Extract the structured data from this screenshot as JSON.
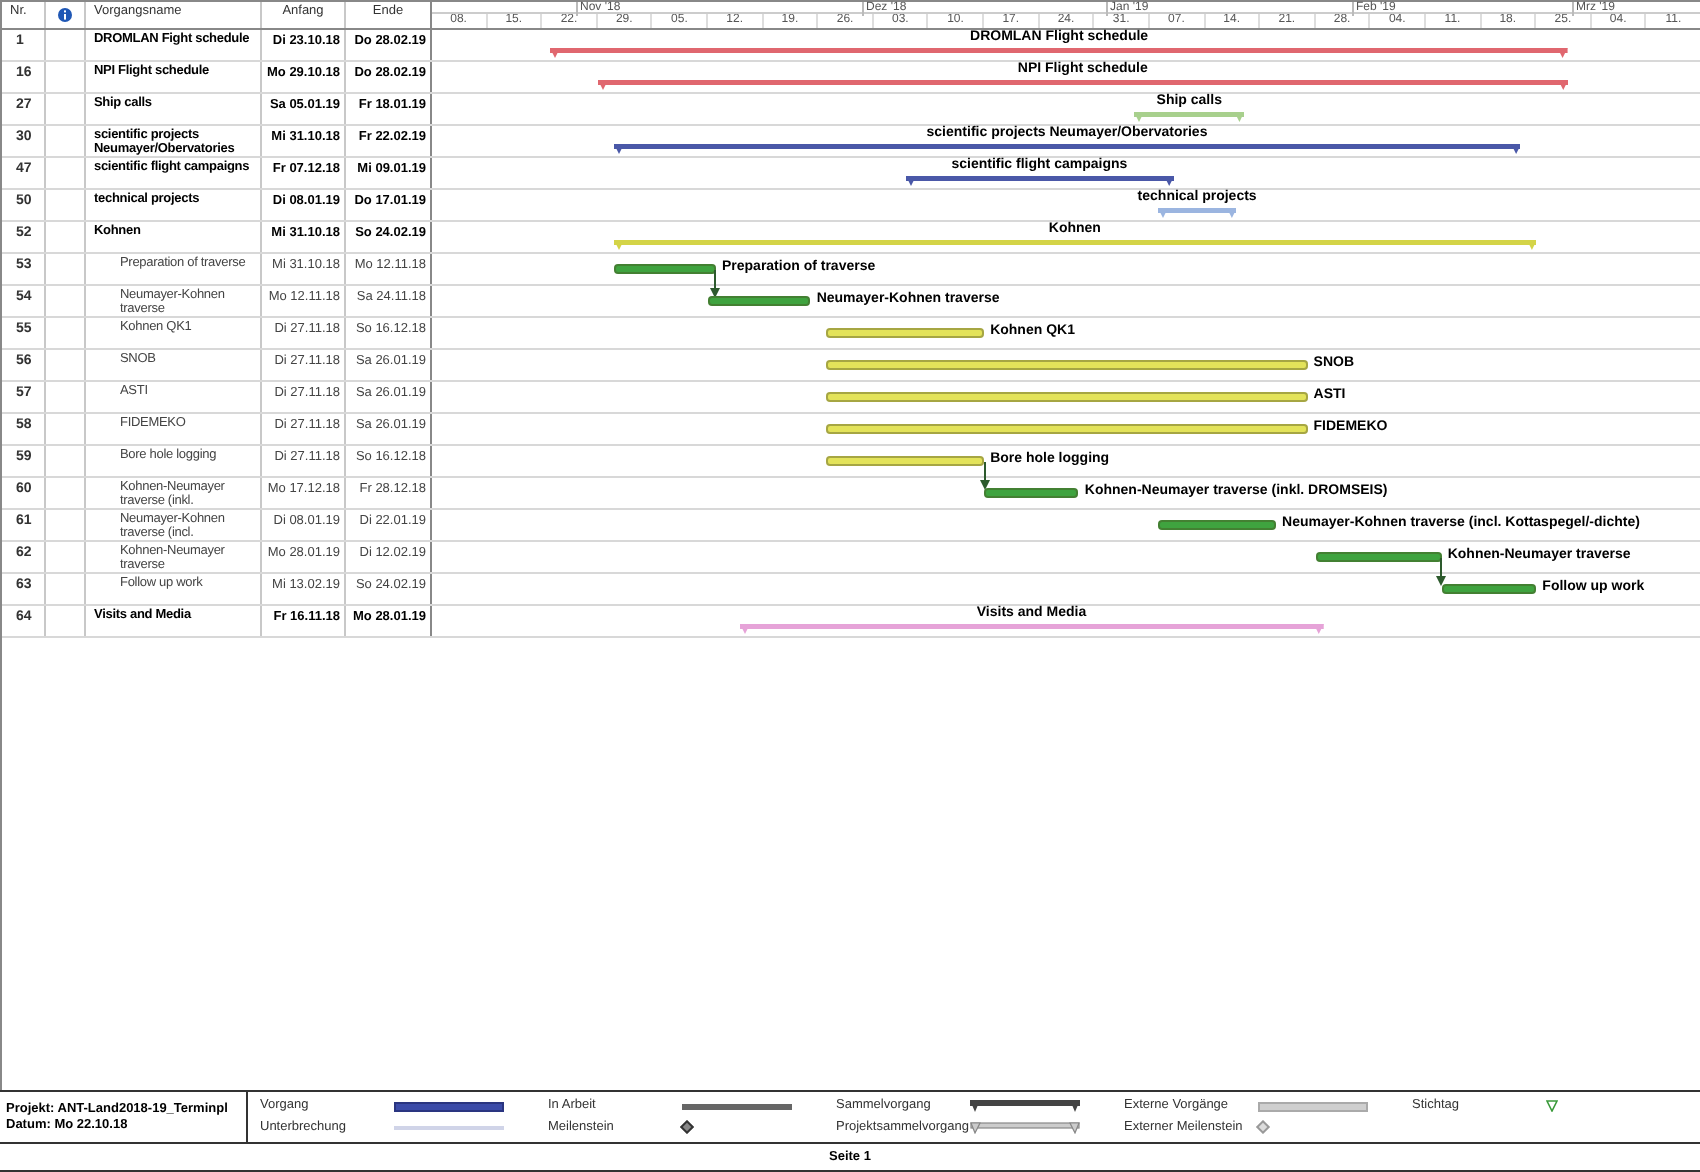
{
  "table": {
    "columns": [
      "Nr.",
      "Vorgangsname",
      "Anfang",
      "Ende"
    ]
  },
  "timeline": {
    "months": [
      "Nov '18",
      "Dez '18",
      "Jan '19",
      "Feb '19",
      "Mrz '19"
    ],
    "weeks": [
      "08.",
      "15.",
      "22.",
      "29.",
      "05.",
      "12.",
      "19.",
      "26.",
      "03.",
      "10.",
      "17.",
      "24.",
      "31.",
      "07.",
      "14.",
      "21.",
      "28.",
      "04.",
      "11.",
      "18.",
      "25.",
      "04.",
      "11."
    ]
  },
  "rows": [
    {
      "id": "1",
      "name": "DROMLAN Fight schedule",
      "start": "Di 23.10.18",
      "end": "Do 28.02.19",
      "kind": "summary",
      "color": "#e0676f",
      "bar_label": "DROMLAN Flight schedule"
    },
    {
      "id": "16",
      "name": "NPI Flight schedule",
      "start": "Mo 29.10.18",
      "end": "Do 28.02.19",
      "kind": "summary",
      "color": "#e0676f",
      "bar_label": "NPI Flight schedule"
    },
    {
      "id": "27",
      "name": "Ship calls",
      "start": "Sa 05.01.19",
      "end": "Fr 18.01.19",
      "kind": "summary",
      "color": "#a8d08d",
      "bar_label": "Ship calls"
    },
    {
      "id": "30",
      "name": "scientific projects Neumayer/Obervatories",
      "start": "Mi 31.10.18",
      "end": "Fr 22.02.19",
      "kind": "summary",
      "color": "#4a58a8",
      "bar_label": "scientific projects Neumayer/Obervatories"
    },
    {
      "id": "47",
      "name": "scientific flight campaigns",
      "start": "Fr 07.12.18",
      "end": "Mi 09.01.19",
      "kind": "summary",
      "color": "#4a58a8",
      "bar_label": "scientific flight campaigns"
    },
    {
      "id": "50",
      "name": "technical projects",
      "start": "Di 08.01.19",
      "end": "Do 17.01.19",
      "kind": "summary",
      "color": "#9bb5e0",
      "bar_label": "technical projects"
    },
    {
      "id": "52",
      "name": "Kohnen",
      "start": "Mi 31.10.18",
      "end": "So 24.02.19",
      "kind": "summary",
      "color": "#d4d448",
      "bar_label": "Kohnen",
      "children": [
        {
          "id": "53",
          "name": "Preparation of traverse",
          "start": "Mi 31.10.18",
          "end": "Mo 12.11.18",
          "kind": "task",
          "color": "#3fa33f",
          "bar_label": "Preparation of traverse",
          "linked": true
        },
        {
          "id": "54",
          "name": "Neumayer-Kohnen traverse",
          "start": "Mo 12.11.18",
          "end": "Sa 24.11.18",
          "kind": "task",
          "color": "#3fa33f",
          "bar_label": "Neumayer-Kohnen traverse",
          "linked": false
        },
        {
          "id": "55",
          "name": "Kohnen QK1",
          "start": "Di 27.11.18",
          "end": "So 16.12.18",
          "kind": "task",
          "color": "#e3e35a",
          "bar_label": "Kohnen QK1",
          "linked": false
        },
        {
          "id": "56",
          "name": "SNOB",
          "start": "Di 27.11.18",
          "end": "Sa 26.01.19",
          "kind": "task",
          "color": "#e3e35a",
          "bar_label": "SNOB",
          "linked": false
        },
        {
          "id": "57",
          "name": "ASTI",
          "start": "Di 27.11.18",
          "end": "Sa 26.01.19",
          "kind": "task",
          "color": "#e3e35a",
          "bar_label": "ASTI",
          "linked": false
        },
        {
          "id": "58",
          "name": "FIDEMEKO",
          "start": "Di 27.11.18",
          "end": "Sa 26.01.19",
          "kind": "task",
          "color": "#e3e35a",
          "bar_label": "FIDEMEKO",
          "linked": false
        },
        {
          "id": "59",
          "name": "Bore hole logging",
          "start": "Di 27.11.18",
          "end": "So 16.12.18",
          "kind": "task",
          "color": "#e3e35a",
          "bar_label": "Bore hole logging",
          "linked": true
        },
        {
          "id": "60",
          "name": "Kohnen-Neumayer traverse (inkl.",
          "start": "Mo 17.12.18",
          "end": "Fr 28.12.18",
          "kind": "task",
          "color": "#3fa33f",
          "bar_label": "Kohnen-Neumayer traverse (inkl. DROMSEIS)",
          "linked": false
        },
        {
          "id": "61",
          "name": "Neumayer-Kohnen traverse (incl.",
          "start": "Di 08.01.19",
          "end": "Di 22.01.19",
          "kind": "task",
          "color": "#3fa33f",
          "bar_label": "Neumayer-Kohnen traverse (incl. Kottaspegel/-dichte)",
          "linked": false
        },
        {
          "id": "62",
          "name": "Kohnen-Neumayer traverse",
          "start": "Mo 28.01.19",
          "end": "Di 12.02.19",
          "kind": "task",
          "color": "#3fa33f",
          "bar_label": "Kohnen-Neumayer traverse",
          "linked": true
        },
        {
          "id": "63",
          "name": "Follow up work",
          "start": "Mi 13.02.19",
          "end": "So 24.02.19",
          "kind": "task",
          "color": "#3fa33f",
          "bar_label": "Follow up work",
          "linked": false
        }
      ]
    },
    {
      "id": "64",
      "name": "Visits and Media",
      "start": "Fr 16.11.18",
      "end": "Mo 28.01.19",
      "kind": "summary",
      "color": "#e6a3d8",
      "bar_label": "Visits and Media"
    }
  ],
  "legend": {
    "project": "Projekt: ANT-Land2018-19_Terminpl",
    "date": "Datum: Mo 22.10.18",
    "items": [
      {
        "label": "Vorgang",
        "kind": "task"
      },
      {
        "label": "Unterbrechung",
        "kind": "split"
      },
      {
        "label": "In Arbeit",
        "kind": "progress"
      },
      {
        "label": "Meilenstein",
        "kind": "milestone"
      },
      {
        "label": "Sammelvorgang",
        "kind": "summary"
      },
      {
        "label": "Projektsammelvorgang",
        "kind": "project_summary"
      },
      {
        "label": "Externe Vorgänge",
        "kind": "external_task"
      },
      {
        "label": "Externer Meilenstein",
        "kind": "external_milestone"
      },
      {
        "label": "Stichtag",
        "kind": "deadline"
      }
    ]
  },
  "footer": "Seite 1"
}
